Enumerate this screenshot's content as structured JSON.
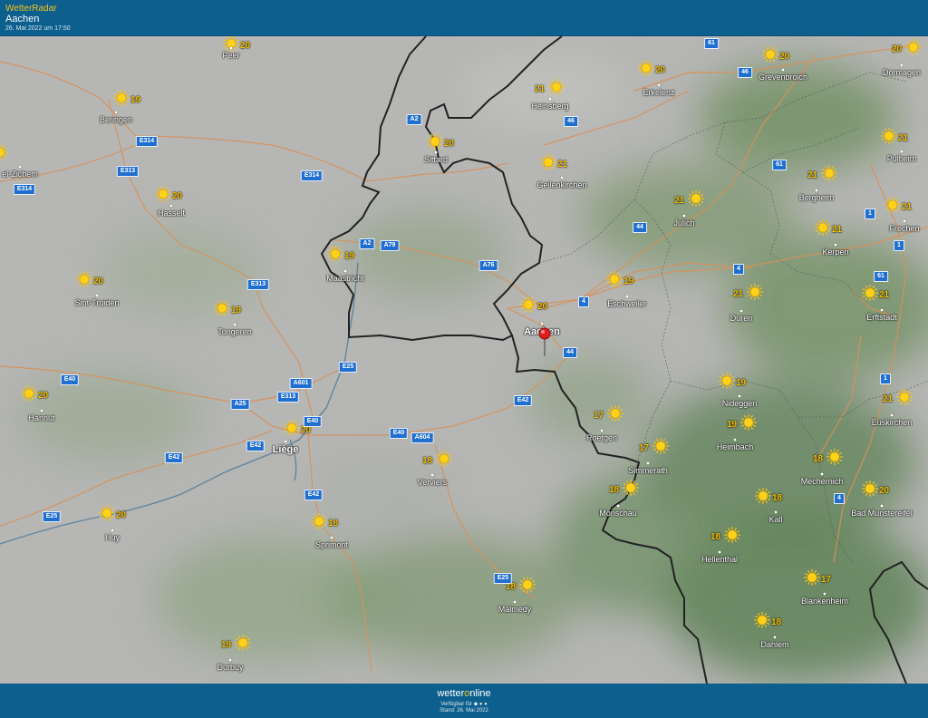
{
  "header": {
    "app_title": "WetterRadar",
    "location": "Aachen",
    "timestamp": "26. Mai 2022 um 17:50"
  },
  "colors": {
    "header_bg": "#0d5f8e",
    "app_title": "#f5c518",
    "temperature": "#f7c200",
    "road_badge": "#1f6fd1",
    "border": "#222222",
    "highway": "#d8915a",
    "river": "#5a7f9a",
    "pin": "#e01e1e"
  },
  "map": {
    "selected_location": "Aachen",
    "places": [
      {
        "name": "Peer",
        "temp": "20",
        "weather": "sun"
      },
      {
        "name": "Beringen",
        "temp": "19",
        "weather": "sun"
      },
      {
        "name": "el-Zichem",
        "temp": "",
        "weather": "sun"
      },
      {
        "name": "Hasselt",
        "temp": "20",
        "weather": "sun"
      },
      {
        "name": "Sint-Truiden",
        "temp": "20",
        "weather": "sun"
      },
      {
        "name": "Tongeren",
        "temp": "19",
        "weather": "sun"
      },
      {
        "name": "Maastricht",
        "temp": "19",
        "weather": "sun"
      },
      {
        "name": "Hannut",
        "temp": "20",
        "weather": "sun"
      },
      {
        "name": "Liège",
        "temp": "20",
        "weather": "sun"
      },
      {
        "name": "Huy",
        "temp": "20",
        "weather": "sun"
      },
      {
        "name": "Sprimont",
        "temp": "18",
        "weather": "sun"
      },
      {
        "name": "Verviers",
        "temp": "18",
        "weather": "sun"
      },
      {
        "name": "Durbuy",
        "temp": "19",
        "weather": "sun"
      },
      {
        "name": "Malmedy",
        "temp": "18",
        "weather": "sun"
      },
      {
        "name": "Sittard",
        "temp": "20",
        "weather": "sun"
      },
      {
        "name": "Heinsberg",
        "temp": "21",
        "weather": "sun"
      },
      {
        "name": "Geilenkirchen",
        "temp": "21",
        "weather": "sun"
      },
      {
        "name": "Erkelenz",
        "temp": "20",
        "weather": "sun"
      },
      {
        "name": "Grevenbroich",
        "temp": "20",
        "weather": "sun"
      },
      {
        "name": "Dormagen",
        "temp": "20",
        "weather": "sun"
      },
      {
        "name": "Pulheim",
        "temp": "21",
        "weather": "sun"
      },
      {
        "name": "Bergheim",
        "temp": "21",
        "weather": "sun"
      },
      {
        "name": "Frechen",
        "temp": "21",
        "weather": "sun"
      },
      {
        "name": "Kerpen",
        "temp": "21",
        "weather": "sun"
      },
      {
        "name": "Julich",
        "temp": "21",
        "weather": "sun"
      },
      {
        "name": "Aachen",
        "temp": "20",
        "weather": "sun"
      },
      {
        "name": "Eschweiler",
        "temp": "19",
        "weather": "sun"
      },
      {
        "name": "Duren",
        "temp": "21",
        "weather": "sun"
      },
      {
        "name": "Erftstadt",
        "temp": "21",
        "weather": "sun"
      },
      {
        "name": "Nideggen",
        "temp": "19",
        "weather": "sun"
      },
      {
        "name": "Euskirchen",
        "temp": "21",
        "weather": "sun"
      },
      {
        "name": "Roetgen",
        "temp": "17",
        "weather": "sun"
      },
      {
        "name": "Heimbach",
        "temp": "19",
        "weather": "sun"
      },
      {
        "name": "Simmerath",
        "temp": "17",
        "weather": "sun"
      },
      {
        "name": "Mechernich",
        "temp": "18",
        "weather": "sun"
      },
      {
        "name": "Monschau",
        "temp": "18",
        "weather": "sun"
      },
      {
        "name": "Kall",
        "temp": "18",
        "weather": "sun"
      },
      {
        "name": "Bad Munstereifel",
        "temp": "20",
        "weather": "sun"
      },
      {
        "name": "Hellenthal",
        "temp": "18",
        "weather": "sun"
      },
      {
        "name": "Blankenheim",
        "temp": "17",
        "weather": "sun"
      },
      {
        "name": "Dahlem",
        "temp": "18",
        "weather": "sun"
      }
    ],
    "roads": [
      "61",
      "46",
      "46",
      "A2",
      "E314",
      "E314",
      "E313",
      "E314",
      "E313",
      "A2",
      "A79",
      "A76",
      "44",
      "4",
      "4",
      "1",
      "61",
      "61",
      "1",
      "1",
      "4",
      "44",
      "E25",
      "A601",
      "E313",
      "E40",
      "A25",
      "E40",
      "E40",
      "E42",
      "A604",
      "E42",
      "E42",
      "E25",
      "E42",
      "E25"
    ]
  },
  "footer": {
    "brand_left": "wetter",
    "brand_o": "o",
    "brand_right": "nline",
    "available": "Verfügbar für ◆ ● ●",
    "status": "Stand: 26. Mai 2022"
  }
}
